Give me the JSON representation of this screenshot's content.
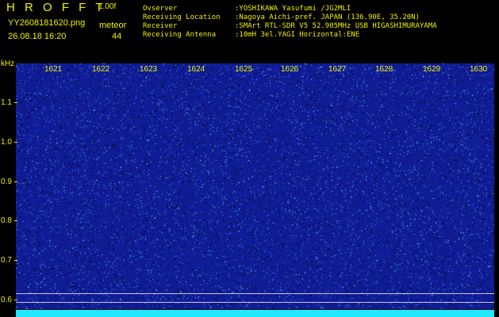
{
  "header": {
    "app_title": "H R O F F T",
    "app_version": "1.00f",
    "file_name": "YY2608181620.png",
    "datetime": "26.08.18 16:20",
    "meteor_label": "meteor",
    "meteor_count": "44"
  },
  "info": [
    {
      "label": "Ovserver",
      "value": ":YOSHIKAWA Yasufumi /JG2MLI"
    },
    {
      "label": "Receiving Location",
      "value": ":Nagoya Aichi-pref. JAPAN (136.90E, 35.20N)"
    },
    {
      "label": "Receiver",
      "value": ":SMArt RTL-SDR V5 52.905MHz USB HIGASHIMURAYAMA"
    },
    {
      "label": "Receiving Antenna",
      "value": ":10mH 3el.YAGI Horizontal:ENE"
    }
  ],
  "axis": {
    "y_unit": "kHz",
    "y_ticks": [
      "1.1",
      "1.0",
      "0.9",
      "0.8",
      "0.7",
      "0.6"
    ],
    "x_ticks": [
      "1621",
      "1622",
      "1623",
      "1624",
      "1625",
      "1626",
      "1627",
      "1628",
      "1629",
      "1630"
    ]
  },
  "colors": {
    "text": "#f0f000",
    "background": "#101c96",
    "noise_light": "#40a0ff",
    "noise_bright": "#60f0ff",
    "strip": "#20e8ff"
  }
}
